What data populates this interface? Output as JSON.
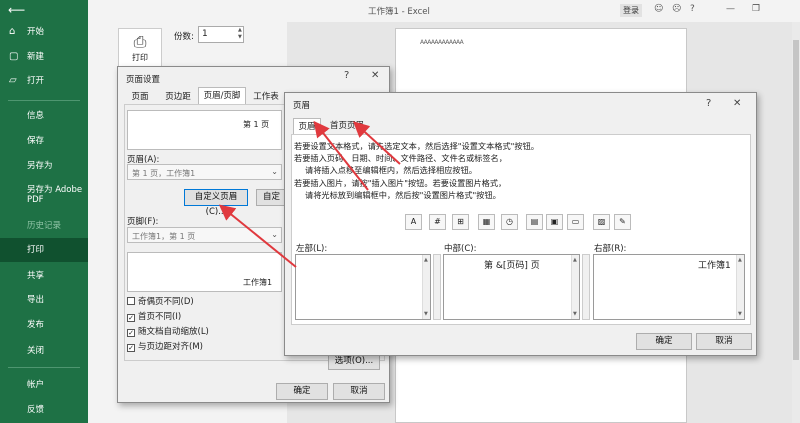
{
  "window": {
    "title": "工作簿1 - Excel",
    "login_label": "登录",
    "icons": [
      "smile-icon",
      "frown-icon",
      "help-icon",
      "minimize-icon",
      "restore-icon"
    ]
  },
  "sidebar": {
    "items": [
      {
        "label": "开始",
        "icon": "home-icon"
      },
      {
        "label": "新建",
        "icon": "new-file-icon"
      },
      {
        "label": "打开",
        "icon": "folder-open-icon"
      },
      {
        "label": "信息"
      },
      {
        "label": "保存"
      },
      {
        "label": "另存为"
      },
      {
        "label": "另存为 Adobe PDF"
      },
      {
        "label": "历史记录"
      },
      {
        "label": "打印"
      },
      {
        "label": "共享"
      },
      {
        "label": "导出"
      },
      {
        "label": "发布"
      },
      {
        "label": "关闭"
      },
      {
        "label": "帐户"
      },
      {
        "label": "反馈"
      }
    ],
    "active": "打印",
    "colors": {
      "bg": "#1e7145",
      "active": "#10512f"
    }
  },
  "print": {
    "button_label": "打印",
    "copies_label": "份数:",
    "copies_value": "1"
  },
  "preview": {
    "header_text": "ΑΑΑΑΑΑΑΑΑΑΑΑ"
  },
  "page_setup": {
    "title": "页面设置",
    "help": "?",
    "close": "✕",
    "tabs": [
      "页面",
      "页边距",
      "页眉/页脚",
      "工作表"
    ],
    "active_tab": "页眉/页脚",
    "header_preview": "第 1 页",
    "header_label": "页眉(A):",
    "header_value": "第 1 页，工作簿1",
    "custom_header_btn": "自定义页眉(C)...",
    "custom_footer_btn": "自定义",
    "footer_label": "页脚(F):",
    "footer_value": "工作簿1，第 1 页",
    "footer_preview": "工作簿1",
    "checks": [
      {
        "label": "奇偶页不同(D)",
        "checked": false
      },
      {
        "label": "首页不同(I)",
        "checked": true
      },
      {
        "label": "随文档自动缩放(L)",
        "checked": true
      },
      {
        "label": "与页边距对齐(M)",
        "checked": true
      }
    ],
    "options_btn": "选项(O)...",
    "ok": "确定",
    "cancel": "取消"
  },
  "header_dialog": {
    "title": "页眉",
    "help": "?",
    "close": "✕",
    "tabs": [
      "页眉",
      "首页页眉"
    ],
    "active_tab": "页眉",
    "instructions": [
      "若要设置文本格式，请先选定文本，然后选择\"设置文本格式\"按钮。",
      "若要插入页码、日期、时间、文件路径、文件名或标签名，",
      "请将插入点移至编辑框内，然后选择相应按钮。",
      "若要插入图片，请按\"插入图片\"按钮。若要设置图片格式，",
      "请将光标放到编辑框中，然后按\"设置图片格式\"按钮。"
    ],
    "toolbar": [
      {
        "name": "format-text-icon",
        "glyph": "A"
      },
      {
        "name": "insert-page-number-icon",
        "glyph": "#"
      },
      {
        "name": "insert-page-count-icon",
        "glyph": "⊞"
      },
      {
        "name": "insert-date-icon",
        "glyph": "▦"
      },
      {
        "name": "insert-time-icon",
        "glyph": "◷"
      },
      {
        "name": "insert-file-path-icon",
        "glyph": "▤"
      },
      {
        "name": "insert-file-name-icon",
        "glyph": "▣"
      },
      {
        "name": "insert-sheet-name-icon",
        "glyph": "▭"
      },
      {
        "name": "insert-picture-icon",
        "glyph": "▨"
      },
      {
        "name": "format-picture-icon",
        "glyph": "✎"
      }
    ],
    "left_label": "左部(L):",
    "center_label": "中部(C):",
    "right_label": "右部(R):",
    "left_value": "",
    "center_value": "第 &[页码] 页",
    "right_value": "工作簿1",
    "ok": "确定",
    "cancel": "取消",
    "arrow_color": "#e0393e"
  }
}
